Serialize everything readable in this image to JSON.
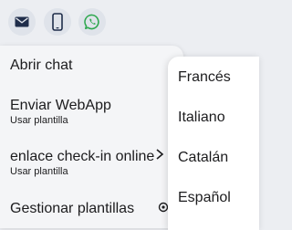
{
  "toolbar": {
    "icons": [
      "mail-icon",
      "phone-icon",
      "whatsapp-icon"
    ],
    "accent_whatsapp": "#2fa84f",
    "icon_color": "#1f2d4a"
  },
  "menu": {
    "items": [
      {
        "title": "Abrir chat"
      },
      {
        "title": "Enviar WebApp",
        "subtitle": "Usar plantilla"
      },
      {
        "title": "enlace check-in online",
        "subtitle": "Usar plantilla"
      },
      {
        "title": "Gestionar plantillas"
      }
    ]
  },
  "submenu": {
    "items": [
      "Francés",
      "Italiano",
      "Catalán",
      "Español"
    ]
  }
}
